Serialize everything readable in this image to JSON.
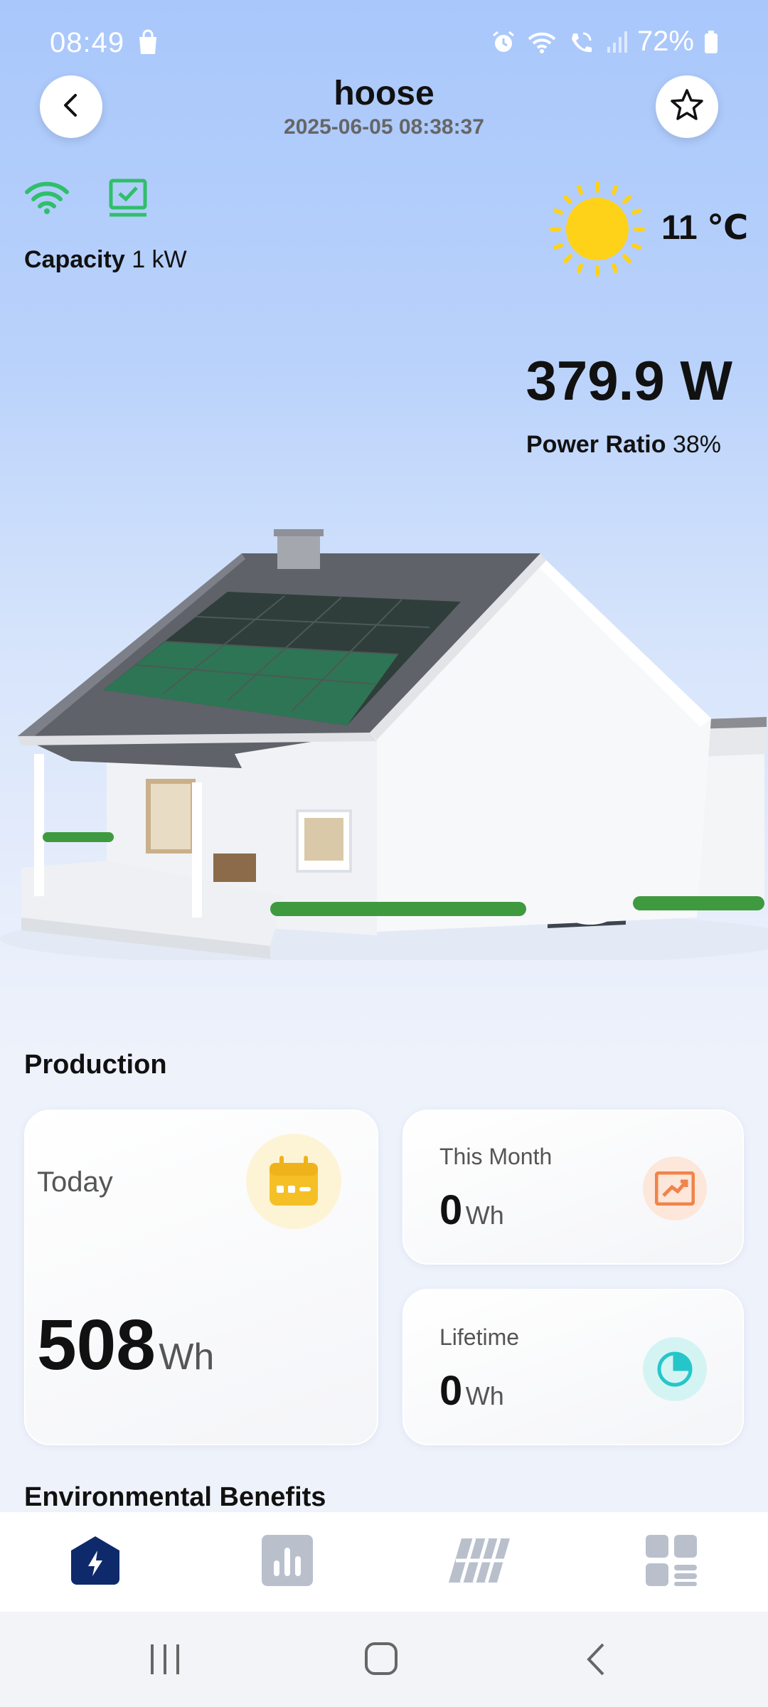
{
  "status_bar": {
    "time": "08:49",
    "battery": "72%",
    "icons": [
      "shopping-bag-icon",
      "alarm-icon",
      "wifi-icon",
      "wifi-call-icon",
      "signal-icon",
      "battery-icon"
    ]
  },
  "header": {
    "title": "hoose",
    "datetime": "2025-06-05 08:38:37",
    "back_icon": "chevron-left-icon",
    "favorite_icon": "star-icon"
  },
  "device": {
    "capacity_label": "Capacity",
    "capacity_value": "1 kW",
    "connection_icon": "wifi-icon",
    "status_icon": "monitor-check-icon"
  },
  "weather": {
    "icon": "sun-icon",
    "temperature": "11 ℃"
  },
  "power": {
    "value": "379.9 W",
    "ratio_label": "Power Ratio",
    "ratio_value": "38%"
  },
  "production": {
    "title": "Production",
    "today": {
      "label": "Today",
      "value": "508",
      "unit": "Wh",
      "icon": "calendar-icon"
    },
    "month": {
      "label": "This Month",
      "value": "0",
      "unit": "Wh",
      "icon": "trend-chart-icon"
    },
    "lifetime": {
      "label": "Lifetime",
      "value": "0",
      "unit": "Wh",
      "icon": "pie-chart-icon"
    }
  },
  "environmental": {
    "title": "Environmental Benefits"
  },
  "bottom_nav": {
    "items": [
      {
        "name": "overview",
        "icon": "lightning-icon",
        "active": true
      },
      {
        "name": "statistics",
        "icon": "bar-chart-icon",
        "active": false
      },
      {
        "name": "panels",
        "icon": "solar-panel-icon",
        "active": false
      },
      {
        "name": "more",
        "icon": "grid-menu-icon",
        "active": false
      }
    ]
  },
  "colors": {
    "accent_navy": "#0f2a6b",
    "green": "#2fbf6a",
    "sun": "#ffd21a",
    "calendar": "#f5c026",
    "trend": "#f0844a",
    "pie": "#25c6c9"
  }
}
